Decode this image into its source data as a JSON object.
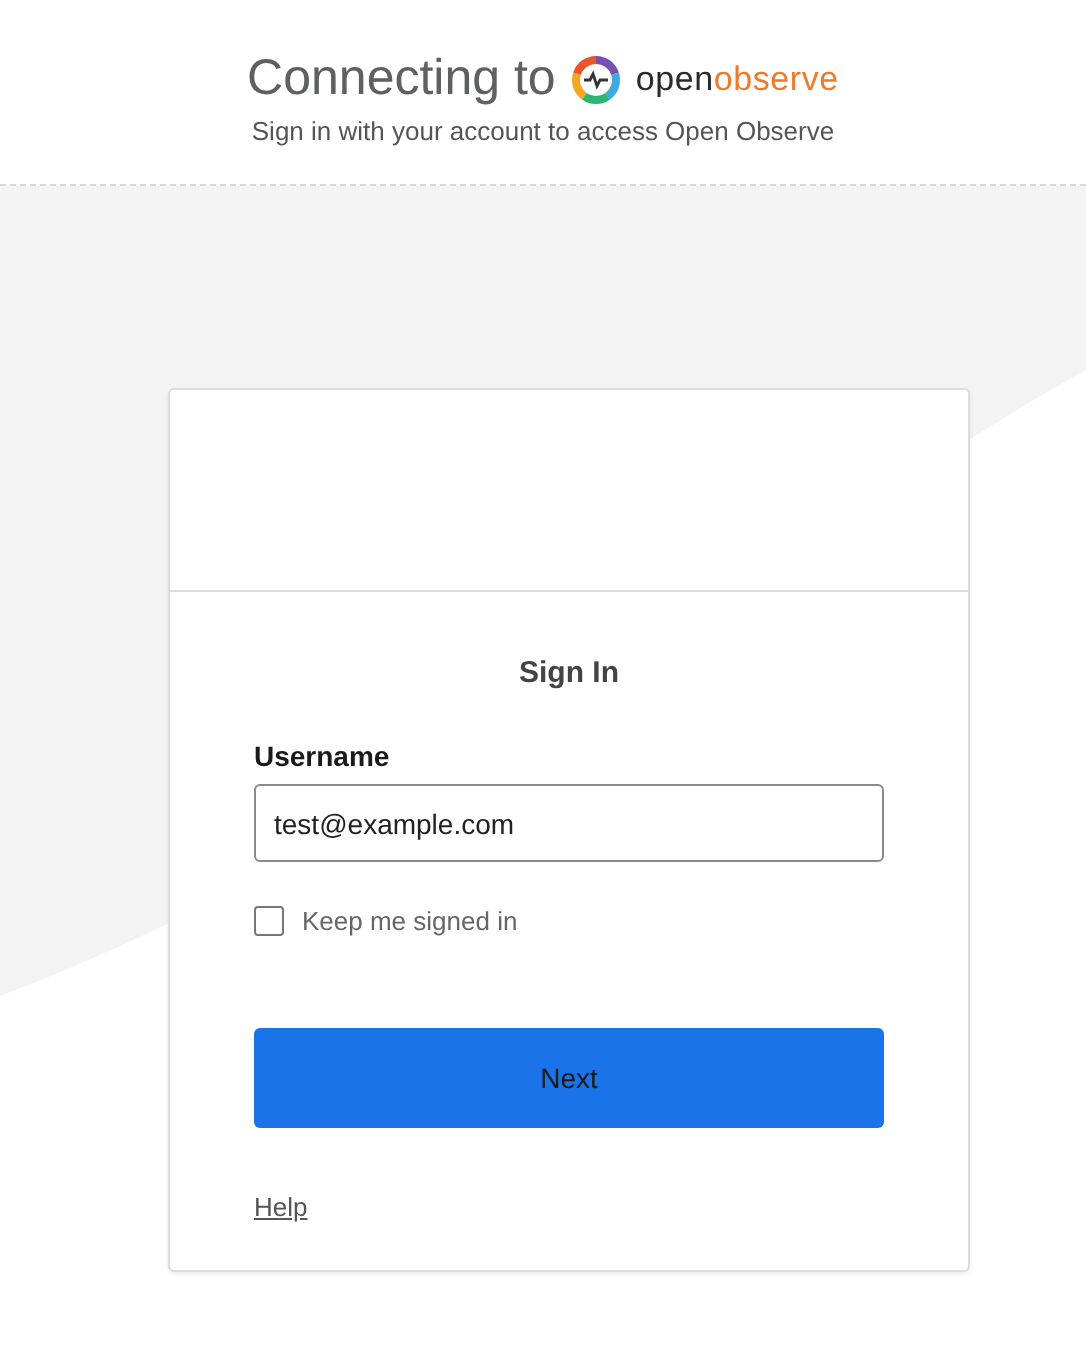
{
  "header": {
    "title": "Connecting to",
    "logo_parts": [
      "open",
      "observe"
    ],
    "subtitle": "Sign in with your account to access Open Observe"
  },
  "form": {
    "heading": "Sign In",
    "username_label": "Username",
    "username_value": "test@example.com",
    "keep_signed_in": {
      "label": "Keep me signed in",
      "checked": false
    },
    "submit": "Next",
    "help_link": "Help"
  }
}
